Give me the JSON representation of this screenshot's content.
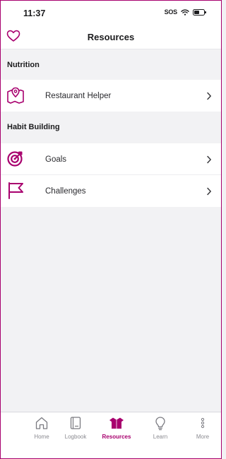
{
  "status_bar": {
    "time": "11:37",
    "sos": "SOS"
  },
  "nav": {
    "title": "Resources"
  },
  "sections": [
    {
      "title": "Nutrition",
      "items": [
        {
          "label": "Restaurant Helper"
        }
      ]
    },
    {
      "title": "Habit Building",
      "items": [
        {
          "label": "Goals"
        },
        {
          "label": "Challenges"
        }
      ]
    }
  ],
  "tabs": [
    {
      "label": "Home",
      "icon": "home-icon"
    },
    {
      "label": "Logbook",
      "icon": "logbook-icon"
    },
    {
      "label": "Resources",
      "icon": "resources-box-icon",
      "active": true
    },
    {
      "label": "Learn",
      "icon": "lightbulb-icon"
    },
    {
      "label": "More",
      "icon": "more-dots-icon"
    }
  ],
  "colors": {
    "accent": "#a8006e",
    "background": "#f2f2f4",
    "surface": "#ffffff",
    "text": "#1c1c1e"
  }
}
